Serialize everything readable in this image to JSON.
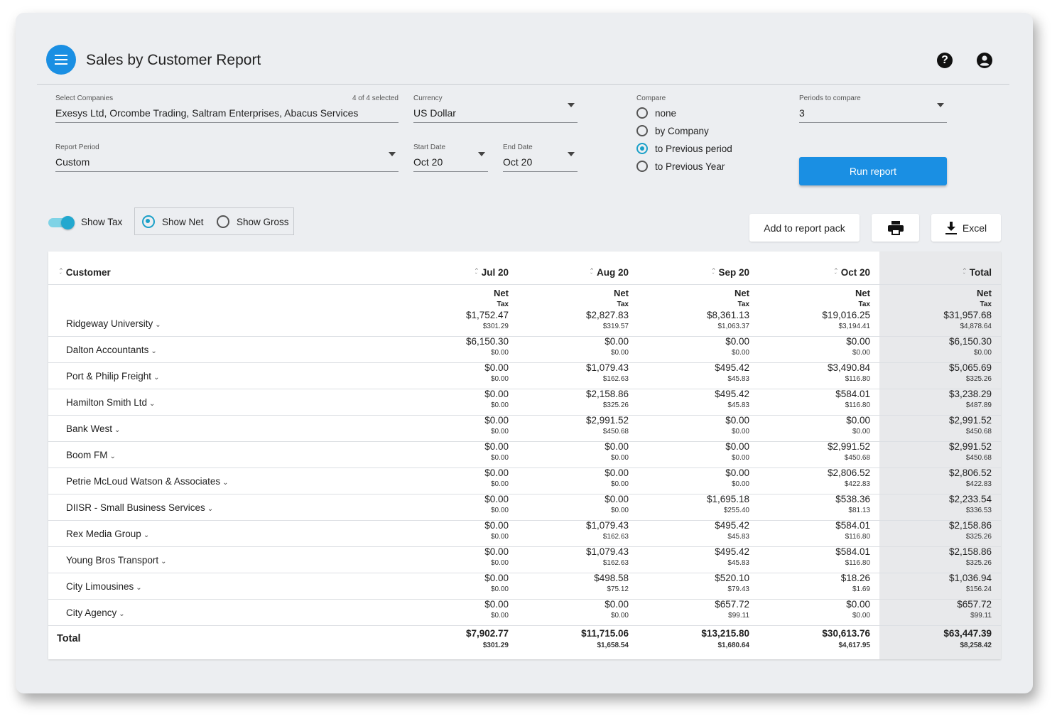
{
  "header": {
    "title": "Sales by Customer Report"
  },
  "filters": {
    "companies": {
      "label": "Select Companies",
      "selected_count": "4 of 4 selected",
      "value": "Exesys Ltd, Orcombe Trading, Saltram Enterprises, Abacus Services"
    },
    "currency": {
      "label": "Currency",
      "value": "US Dollar"
    },
    "report_period": {
      "label": "Report Period",
      "value": "Custom"
    },
    "start_date": {
      "label": "Start Date",
      "value": "Oct 20"
    },
    "end_date": {
      "label": "End Date",
      "value": "Oct 20"
    },
    "compare": {
      "label": "Compare",
      "options": [
        "none",
        "by Company",
        "to Previous period",
        "to Previous Year"
      ],
      "selected": "to Previous period"
    },
    "periods_to_compare": {
      "label": "Periods to compare",
      "value": "3"
    },
    "run_label": "Run report"
  },
  "options": {
    "show_tax": "Show Tax",
    "show_tax_on": true,
    "show_net": "Show Net",
    "show_gross": "Show Gross",
    "selected_mode": "Show Net"
  },
  "actions": {
    "add_to_pack": "Add to report pack",
    "excel": "Excel"
  },
  "table": {
    "columns": [
      "Customer",
      "Jul 20",
      "Aug 20",
      "Sep 20",
      "Oct 20",
      "Total"
    ],
    "net_label": "Net",
    "tax_label": "Tax",
    "rows": [
      {
        "name": "Ridgeway University",
        "net": [
          "$1,752.47",
          "$2,827.83",
          "$8,361.13",
          "$19,016.25",
          "$31,957.68"
        ],
        "tax": [
          "$301.29",
          "$319.57",
          "$1,063.37",
          "$3,194.41",
          "$4,878.64"
        ]
      },
      {
        "name": "Dalton Accountants",
        "net": [
          "$6,150.30",
          "$0.00",
          "$0.00",
          "$0.00",
          "$6,150.30"
        ],
        "tax": [
          "$0.00",
          "$0.00",
          "$0.00",
          "$0.00",
          "$0.00"
        ]
      },
      {
        "name": "Port & Philip Freight",
        "net": [
          "$0.00",
          "$1,079.43",
          "$495.42",
          "$3,490.84",
          "$5,065.69"
        ],
        "tax": [
          "$0.00",
          "$162.63",
          "$45.83",
          "$116.80",
          "$325.26"
        ]
      },
      {
        "name": "Hamilton Smith Ltd",
        "net": [
          "$0.00",
          "$2,158.86",
          "$495.42",
          "$584.01",
          "$3,238.29"
        ],
        "tax": [
          "$0.00",
          "$325.26",
          "$45.83",
          "$116.80",
          "$487.89"
        ]
      },
      {
        "name": "Bank West",
        "net": [
          "$0.00",
          "$2,991.52",
          "$0.00",
          "$0.00",
          "$2,991.52"
        ],
        "tax": [
          "$0.00",
          "$450.68",
          "$0.00",
          "$0.00",
          "$450.68"
        ]
      },
      {
        "name": "Boom FM",
        "net": [
          "$0.00",
          "$0.00",
          "$0.00",
          "$2,991.52",
          "$2,991.52"
        ],
        "tax": [
          "$0.00",
          "$0.00",
          "$0.00",
          "$450.68",
          "$450.68"
        ]
      },
      {
        "name": "Petrie McLoud Watson & Associates",
        "net": [
          "$0.00",
          "$0.00",
          "$0.00",
          "$2,806.52",
          "$2,806.52"
        ],
        "tax": [
          "$0.00",
          "$0.00",
          "$0.00",
          "$422.83",
          "$422.83"
        ]
      },
      {
        "name": "DIISR - Small Business Services",
        "net": [
          "$0.00",
          "$0.00",
          "$1,695.18",
          "$538.36",
          "$2,233.54"
        ],
        "tax": [
          "$0.00",
          "$0.00",
          "$255.40",
          "$81.13",
          "$336.53"
        ]
      },
      {
        "name": "Rex Media Group",
        "net": [
          "$0.00",
          "$1,079.43",
          "$495.42",
          "$584.01",
          "$2,158.86"
        ],
        "tax": [
          "$0.00",
          "$162.63",
          "$45.83",
          "$116.80",
          "$325.26"
        ]
      },
      {
        "name": "Young Bros Transport",
        "net": [
          "$0.00",
          "$1,079.43",
          "$495.42",
          "$584.01",
          "$2,158.86"
        ],
        "tax": [
          "$0.00",
          "$162.63",
          "$45.83",
          "$116.80",
          "$325.26"
        ]
      },
      {
        "name": "City Limousines",
        "net": [
          "$0.00",
          "$498.58",
          "$520.10",
          "$18.26",
          "$1,036.94"
        ],
        "tax": [
          "$0.00",
          "$75.12",
          "$79.43",
          "$1.69",
          "$156.24"
        ]
      },
      {
        "name": "City Agency",
        "net": [
          "$0.00",
          "$0.00",
          "$657.72",
          "$0.00",
          "$657.72"
        ],
        "tax": [
          "$0.00",
          "$0.00",
          "$99.11",
          "$0.00",
          "$99.11"
        ]
      }
    ],
    "total": {
      "name": "Total",
      "net": [
        "$7,902.77",
        "$11,715.06",
        "$13,215.80",
        "$30,613.76",
        "$63,447.39"
      ],
      "tax": [
        "$301.29",
        "$1,658.54",
        "$1,680.64",
        "$4,617.95",
        "$8,258.42"
      ]
    }
  }
}
